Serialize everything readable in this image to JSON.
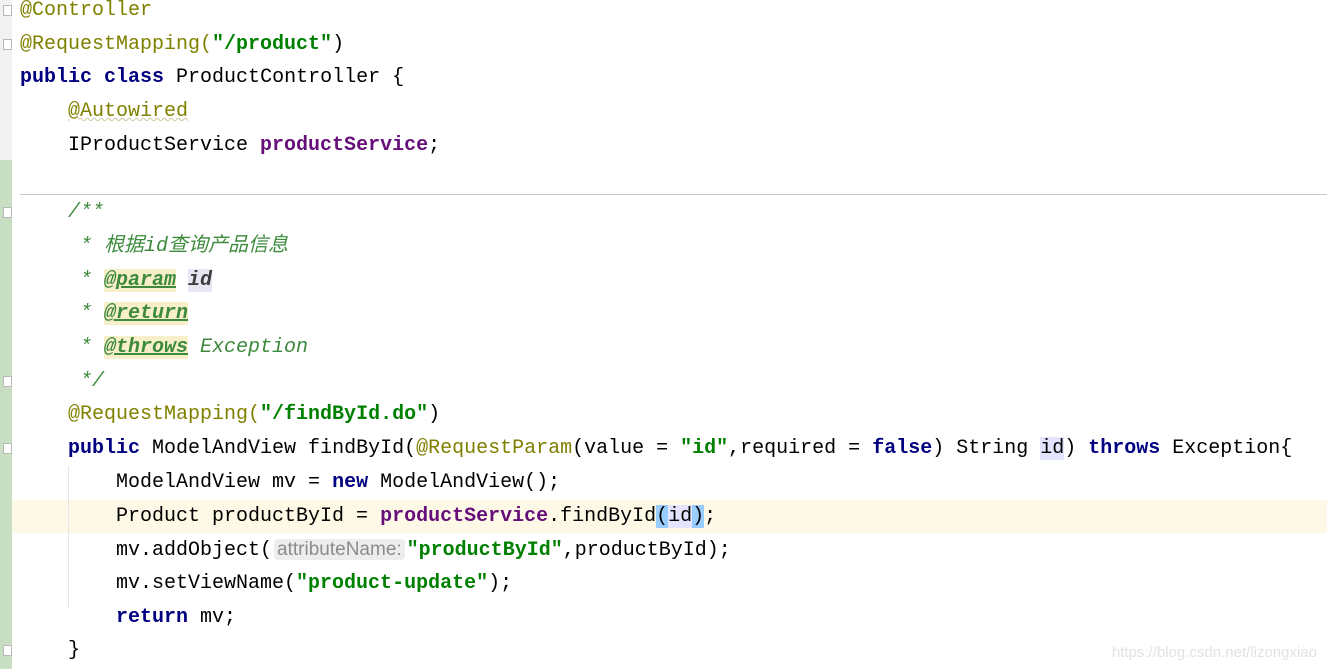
{
  "editor": {
    "colors": {
      "annotation": "#808000",
      "keyword": "#000080",
      "string": "#008000",
      "field": "#660e7a",
      "doc_comment": "#3d8a3d",
      "current_line": "#fdf9e6",
      "brace_match": "#99ccff"
    },
    "fold_lines": [
      0,
      1,
      6,
      11,
      13,
      19
    ],
    "lines": [
      [
        [
          "@Controller",
          "ann"
        ]
      ],
      [
        [
          "@RequestMapping(",
          "ann"
        ],
        [
          "\"/product\"",
          "str"
        ],
        [
          ")",
          ""
        ]
      ],
      [
        [
          "public",
          "kw"
        ],
        [
          " ",
          ""
        ],
        [
          "class",
          "kw"
        ],
        [
          " ProductController {",
          ""
        ]
      ],
      [
        [
          "    ",
          ""
        ],
        [
          "@Autowired",
          "annw"
        ]
      ],
      [
        [
          "    IProductService ",
          ""
        ],
        [
          "productService",
          "field"
        ],
        [
          ";",
          ""
        ]
      ],
      [],
      [
        [
          "    /**",
          "cmt"
        ]
      ],
      [
        [
          "     * 根据id查询产品信息",
          "cmt"
        ]
      ],
      [
        [
          "     * ",
          "cmt"
        ],
        [
          "@param",
          "tag"
        ],
        [
          " ",
          "cmt"
        ],
        [
          "id",
          "pid"
        ]
      ],
      [
        [
          "     * ",
          "cmt"
        ],
        [
          "@return",
          "tag"
        ]
      ],
      [
        [
          "     * ",
          "cmt"
        ],
        [
          "@throws",
          "tag"
        ],
        [
          " Exception",
          "cmt"
        ]
      ],
      [
        [
          "     */",
          "cmt"
        ]
      ],
      [
        [
          "    ",
          ""
        ],
        [
          "@RequestMapping(",
          "ann"
        ],
        [
          "\"/findById.do\"",
          "str"
        ],
        [
          ")",
          ""
        ]
      ],
      [
        [
          "    ",
          ""
        ],
        [
          "public",
          "kw"
        ],
        [
          " ModelAndView findById(",
          ""
        ],
        [
          "@RequestParam",
          "ann"
        ],
        [
          "(value = ",
          ""
        ],
        [
          "\"id\"",
          "str"
        ],
        [
          ",required = ",
          ""
        ],
        [
          "false",
          "kw"
        ],
        [
          ") String ",
          ""
        ],
        [
          "id",
          "hl"
        ],
        [
          ") ",
          ""
        ],
        [
          "throws",
          "kw"
        ],
        [
          " Exception{",
          ""
        ]
      ],
      [
        [
          "        ModelAndView mv = ",
          ""
        ],
        [
          "new",
          "kw"
        ],
        [
          " ModelAndView();",
          ""
        ]
      ],
      [
        [
          "        Product productById = ",
          ""
        ],
        [
          "productService",
          "field"
        ],
        [
          ".findById",
          ""
        ],
        [
          "(",
          "brace"
        ],
        [
          "id",
          "hl"
        ],
        [
          ")",
          "brace"
        ],
        [
          ";",
          ""
        ]
      ],
      [
        [
          "        mv.addObject(",
          ""
        ],
        [
          "attributeName:",
          "hint"
        ],
        [
          "\"productById\"",
          "str"
        ],
        [
          ",productById);",
          ""
        ]
      ],
      [
        [
          "        mv.setViewName(",
          ""
        ],
        [
          "\"product-update\"",
          "str"
        ],
        [
          ");",
          ""
        ]
      ],
      [
        [
          "        ",
          ""
        ],
        [
          "return",
          "kw"
        ],
        [
          " mv;",
          ""
        ]
      ],
      [
        [
          "    }",
          ""
        ]
      ]
    ]
  },
  "watermark": "https://blog.csdn.net/lizongxiao"
}
